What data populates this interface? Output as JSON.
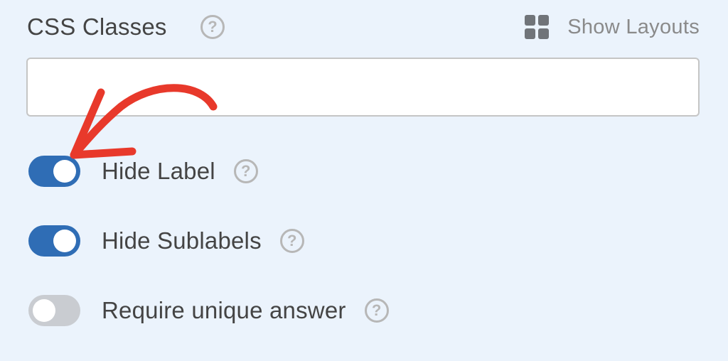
{
  "header": {
    "label": "CSS Classes",
    "help_glyph": "?",
    "layouts_label": "Show Layouts",
    "layouts_icon": "grid-icon"
  },
  "css_input": {
    "value": "",
    "placeholder": ""
  },
  "toggles": [
    {
      "label": "Hide Label",
      "state": "on",
      "help_glyph": "?"
    },
    {
      "label": "Hide Sublabels",
      "state": "on",
      "help_glyph": "?"
    },
    {
      "label": "Require unique answer",
      "state": "off",
      "help_glyph": "?"
    }
  ],
  "colors": {
    "background": "#ebf3fc",
    "toggle_on": "#2f6db5",
    "toggle_off": "#c9ccd1",
    "annotation_arrow": "#e8392b",
    "text": "#444444",
    "muted": "#8a8a8a"
  }
}
